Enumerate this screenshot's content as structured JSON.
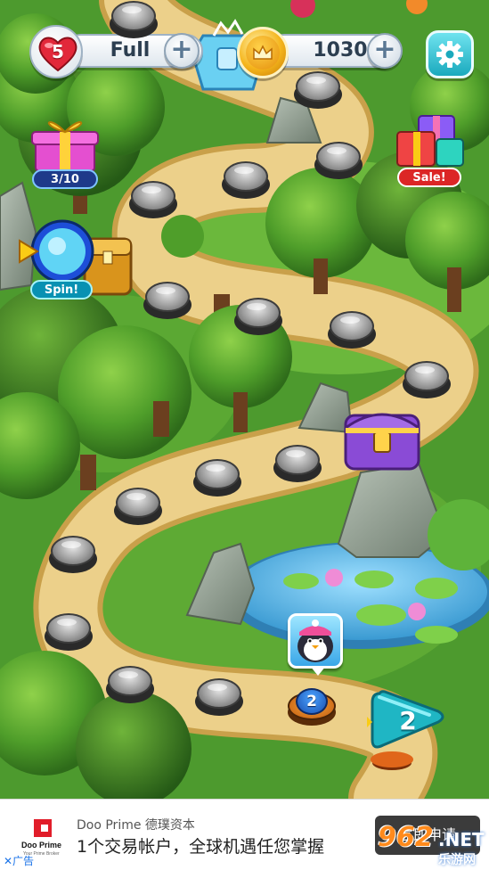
{
  "hud": {
    "lives_count": "5",
    "lives_status": "Full",
    "coins": "1030",
    "add_lives_label": "+",
    "add_coins_label": "+"
  },
  "side_buttons": {
    "gift_progress": "3/10",
    "sale_label": "Sale!",
    "spin_label": "Spin!"
  },
  "map": {
    "current_level_label": "2",
    "play_level_label": "2"
  },
  "ad": {
    "brand_name": "Doo Prime 德璞资本",
    "logo_text": "Doo Prime",
    "headline": "1个交易帐户，全球机遇任您掌握",
    "cta_label": "立即申请",
    "close_label": "✕广告"
  },
  "watermark": {
    "number": "962",
    "net": ".NET",
    "sub": "乐游网"
  },
  "colors": {
    "grass": "#3e8a2a",
    "path": "#e9c878",
    "water": "#5ab8e6",
    "accent_teal": "#1aa9bd",
    "heart_red": "#e2283a",
    "coin_gold": "#f5b51c"
  },
  "icons": [
    "heart-icon",
    "coin-crown-icon",
    "gear-icon",
    "treasure-chest-icon",
    "gift-box-icon",
    "spin-wheel-icon",
    "penguin-avatar-icon",
    "play-arrow-icon"
  ]
}
